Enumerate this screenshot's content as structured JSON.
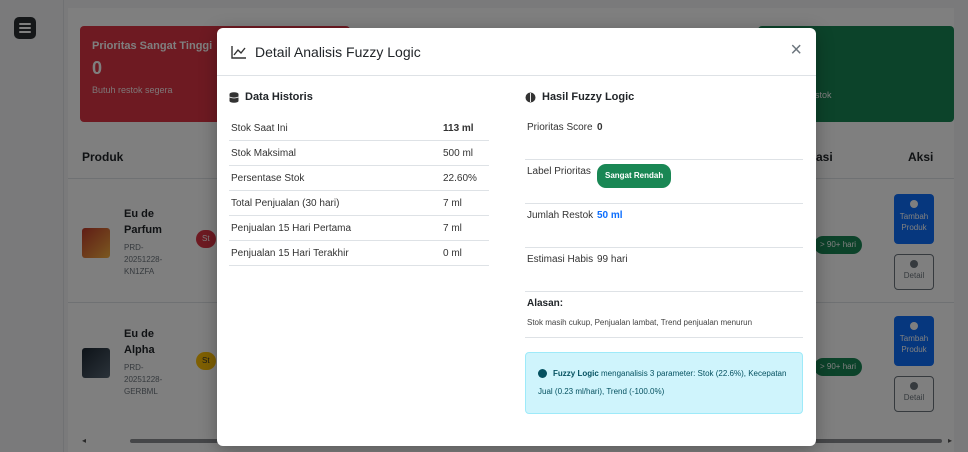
{
  "background": {
    "card_red": {
      "title": "Prioritas Sangat Tinggi",
      "value": "0",
      "subtitle": "Butuh restok segera"
    },
    "card_green": {
      "subtitle": "estok"
    },
    "table_headers": {
      "produk": "Produk",
      "partial": "asi",
      "aksi": "Aksi"
    },
    "products": [
      {
        "name1": "Eu de",
        "name2": "Parfum",
        "code": [
          "PRD-",
          "20251228-",
          "KN1ZFA"
        ],
        "status_partial": "St",
        "estimate": "> 90+ hari",
        "add_label": [
          "Tambah",
          "Produk"
        ],
        "detail_label": "Detail"
      },
      {
        "name1": "Eu de",
        "name2": "Alpha",
        "code": [
          "PRD-",
          "20251228-",
          "GERBML"
        ],
        "status_partial": "St",
        "estimate": "> 90+ hari",
        "add_label": [
          "Tambah",
          "Produk"
        ],
        "detail_label": "Detail"
      }
    ]
  },
  "modal": {
    "title": "Detail Analisis Fuzzy Logic",
    "close": "×",
    "historis": {
      "heading": "Data Historis",
      "rows": [
        {
          "label": "Stok Saat Ini",
          "value": "113 ml"
        },
        {
          "label": "Stok Maksimal",
          "value": "500 ml"
        },
        {
          "label": "Persentase Stok",
          "value": "22.60%"
        },
        {
          "label": "Total Penjualan (30 hari)",
          "value": "7 ml"
        },
        {
          "label": "Penjualan 15 Hari Pertama",
          "value": "7 ml"
        },
        {
          "label": "Penjualan 15 Hari Terakhir",
          "value": "0 ml"
        }
      ]
    },
    "fuzzy": {
      "heading": "Hasil Fuzzy Logic",
      "prioritas_score_label": "Prioritas Score",
      "prioritas_score_value": "0",
      "label_prioritas_label": "Label Prioritas",
      "label_prioritas_value": "Sangat Rendah",
      "jumlah_restok_label": "Jumlah Restok",
      "jumlah_restok_value": "50 ml",
      "estimasi_label": "Estimasi Habis",
      "estimasi_value": "99 hari",
      "alasan_label": "Alasan:",
      "alasan_text": "Stok masih cukup, Penjualan lambat, Trend penjualan menurun",
      "info_bold": "Fuzzy Logic",
      "info_text": "menganalisis 3 parameter: Stok (22.6%), Kecepatan Jual (0.23 ml/hari), Trend (-100.0%)"
    }
  }
}
